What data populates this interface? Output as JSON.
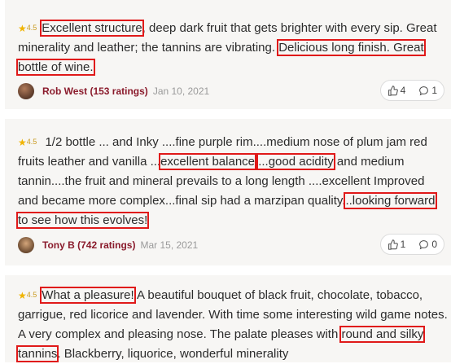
{
  "reviews": [
    {
      "rating": "4.5",
      "highlight1": "Excellent structure",
      "text1": ", deep dark fruit that gets brighter with every sip. Great minerality and leather; the tannins are vibrating. ",
      "highlight2": "Delicious long finish. Great bottle of wine.",
      "user": "Rob West (153 ratings)",
      "date": "Jan 10, 2021",
      "likes": "4",
      "comments": "1"
    },
    {
      "rating": "4.5",
      "text1": " 1/2 bottle ... and Inky ....fine purple rim....medium nose of plum jam red fruits leather and vanilla ...",
      "highlight1": "excellent balance",
      "text2": " ",
      "highlight2": "...good acidity",
      "text3": " and medium tannin....the fruit and mineral prevails to a long length ....excellent Improved and became more complex...final sip had a marzipan quality.",
      "highlight3": "..looking forward to see how this evolves!",
      "user": "Tony B (742 ratings)",
      "date": "Mar 15, 2021",
      "likes": "1",
      "comments": "0"
    },
    {
      "rating": "4.5",
      "highlight1": "What a pleasure!",
      "text1": " A beautiful bouquet of black fruit, chocolate, tobacco, garrigue, red licorice and lavender. With time some interesting wild game notes. A very complex and pleasing nose. The palate pleases with ",
      "highlight2": "round and silky tannins",
      "text2": ". Blackberry, liquorice, wonderful minerality"
    }
  ],
  "colors": {
    "highlight_box": "#e01919",
    "star": "#f0b400",
    "username": "#8a1b2c"
  },
  "icons": {
    "star": "star-icon",
    "like": "thumbs-up-icon",
    "comment": "comment-icon"
  }
}
